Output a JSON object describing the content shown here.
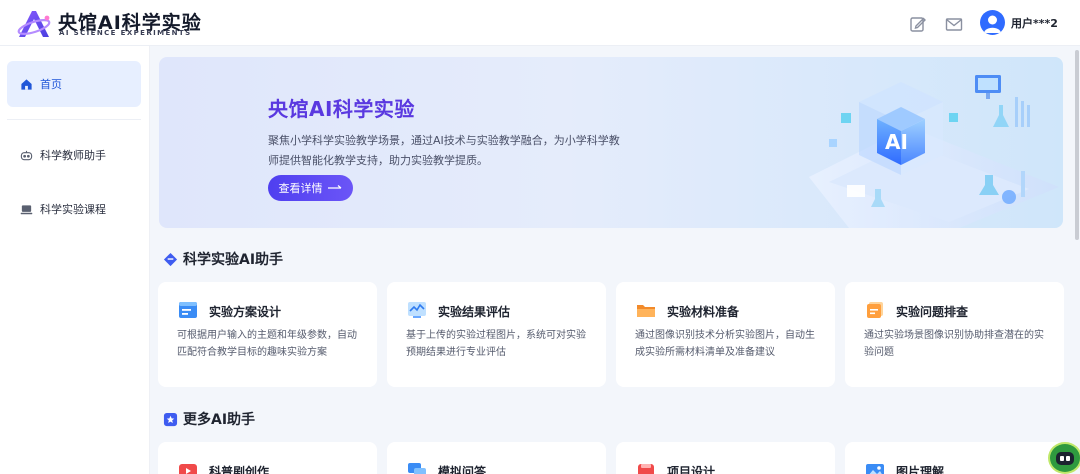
{
  "header": {
    "logo_title": "央馆AI科学实验",
    "logo_subtitle": "AI SCIENCE EXPERIMENTS",
    "icons": [
      "edit-icon",
      "mail-icon"
    ],
    "user_name": "用户***2"
  },
  "sidebar": {
    "items": [
      {
        "label": "首页",
        "icon": "home-icon",
        "active": true
      },
      {
        "label": "科学教师助手",
        "icon": "robot-icon",
        "active": false
      },
      {
        "label": "科学实验课程",
        "icon": "laptop-icon",
        "active": false
      }
    ]
  },
  "banner": {
    "title": "央馆AI科学实验",
    "description": "聚焦小学科学实验教学场景，通过AI技术与实验教学融合，为小学科学教师提供智能化教学支持，助力实验教学提质。",
    "button_label": "查看详情",
    "art_label": "AI"
  },
  "sections": [
    {
      "title": "科学实验AI助手",
      "cards": [
        {
          "title": "实验方案设计",
          "icon": "plan-icon",
          "description": "可根据用户输入的主题和年级参数，自动匹配符合教学目标的趣味实验方案"
        },
        {
          "title": "实验结果评估",
          "icon": "chart-icon",
          "description": "基于上传的实验过程图片，系统可对实验预期结果进行专业评估"
        },
        {
          "title": "实验材料准备",
          "icon": "folder-icon",
          "description": "通过图像识别技术分析实验图片，自动生成实验所需材料清单及准备建议"
        },
        {
          "title": "实验问题排查",
          "icon": "notes-icon",
          "description": "通过实验场景图像识别协助排查潜在的实验问题"
        }
      ]
    },
    {
      "title": "更多AI助手",
      "cards": [
        {
          "title": "科普剧创作",
          "icon": "video-icon"
        },
        {
          "title": "模拟问答",
          "icon": "chat-icon"
        },
        {
          "title": "项目设计",
          "icon": "project-icon"
        },
        {
          "title": "图片理解",
          "icon": "image-icon"
        }
      ]
    }
  ],
  "colors": {
    "accent": "#5a39e0",
    "primary": "#2f6bff",
    "active_bg": "#e7efff"
  }
}
